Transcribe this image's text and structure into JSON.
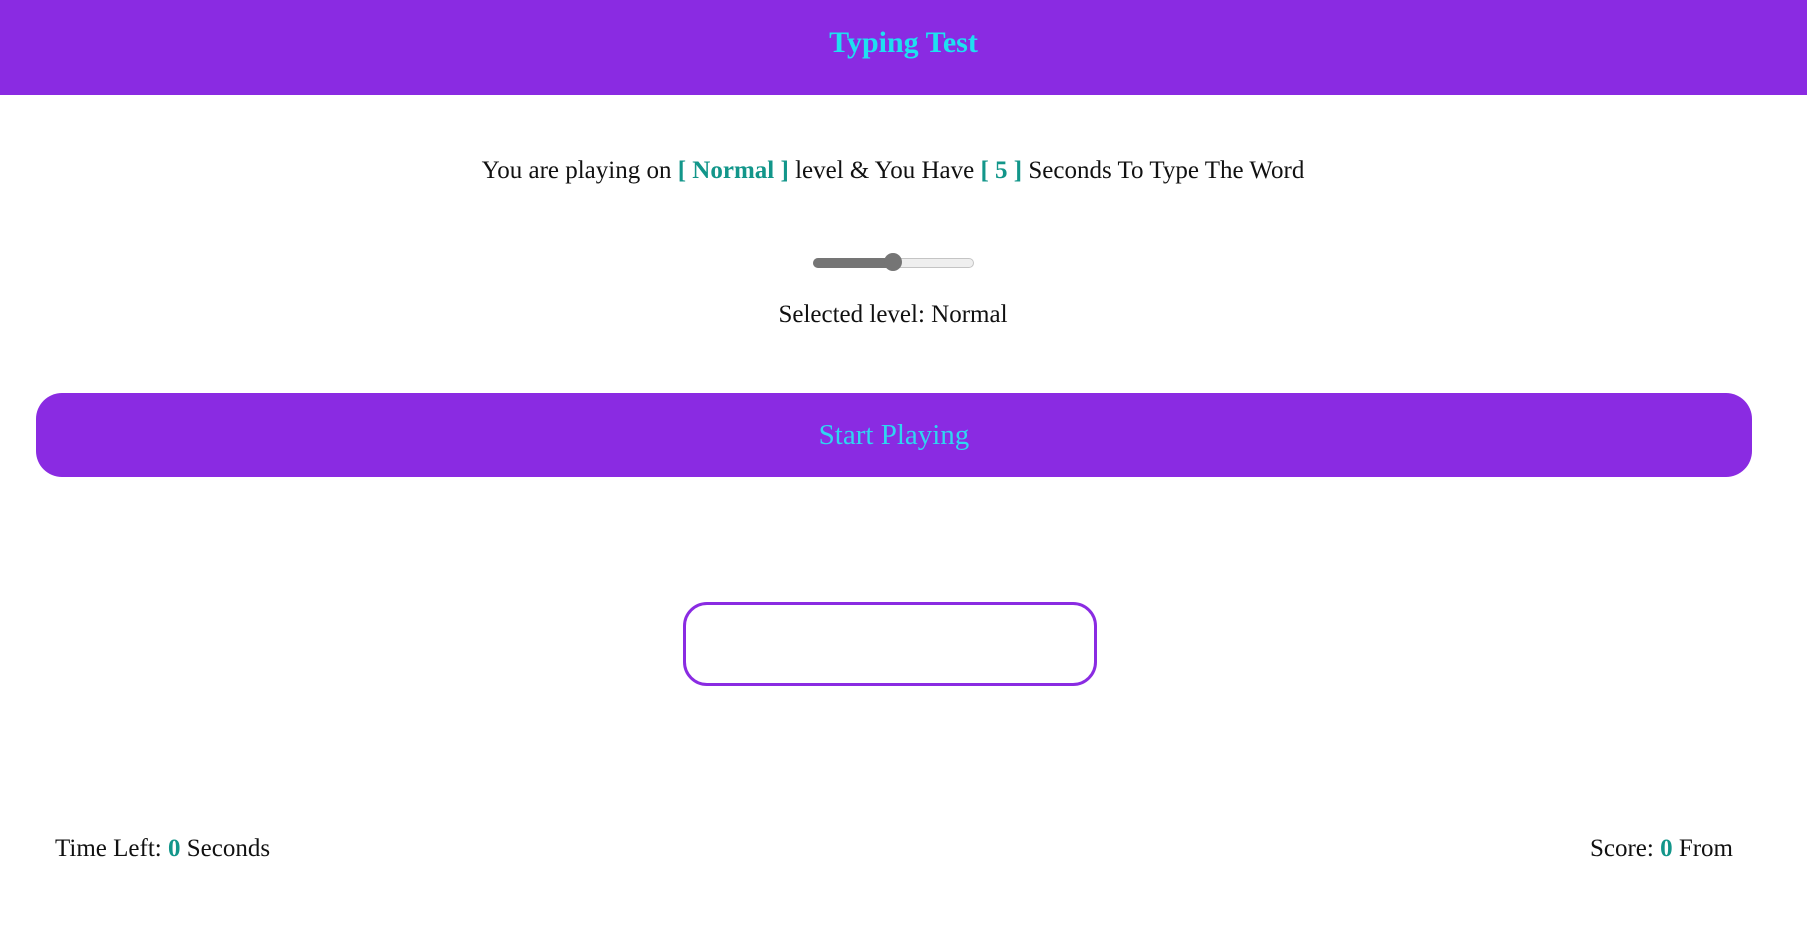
{
  "header": {
    "title": "Typing Test"
  },
  "info": {
    "prefix": "You are playing on",
    "level_badge": "[ Normal ]",
    "middle": "level & You Have",
    "seconds_badge": "[ 5 ]",
    "suffix": "Seconds To Type The Word"
  },
  "level_slider": {
    "value_fraction": 0.5
  },
  "selected_level": {
    "text": "Selected level: Normal"
  },
  "start_button": {
    "label": "Start Playing"
  },
  "word_input": {
    "value": "",
    "placeholder": ""
  },
  "footer": {
    "time_left_label": "Time Left:",
    "time_left_value": "0",
    "time_left_unit": "Seconds",
    "score_label": "Score:",
    "score_value": "0",
    "score_suffix": "From"
  },
  "colors": {
    "brand_purple": "#8a2be2",
    "title_cyan": "#1ee0f0",
    "accent_teal": "#12968a"
  }
}
